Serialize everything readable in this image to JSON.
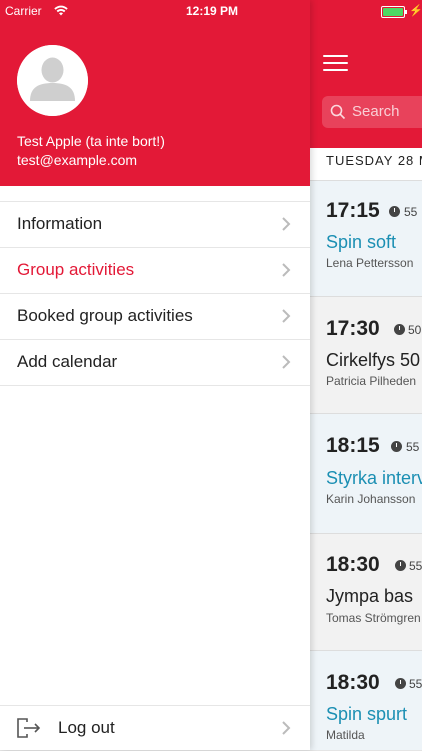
{
  "status_bar": {
    "carrier": "Carrier",
    "time": "12:19 PM"
  },
  "profile": {
    "name": "Test Apple (ta inte bort!)",
    "email": "test@example.com"
  },
  "menu": {
    "items": [
      {
        "label": "Information",
        "active": false
      },
      {
        "label": "Group activities",
        "active": true
      },
      {
        "label": "Booked group activities",
        "active": false
      },
      {
        "label": "Add calendar",
        "active": false
      }
    ],
    "logout_label": "Log out"
  },
  "main": {
    "search_placeholder": "Search",
    "date_header": "TUESDAY 28 M",
    "activities": [
      {
        "time": "17:15",
        "duration": "55",
        "title": "Spin soft",
        "instructor": "Lena Pettersson",
        "style": "teal"
      },
      {
        "time": "17:30",
        "duration": "50",
        "title": "Cirkelfys 50",
        "instructor": "Patricia Pilheden",
        "style": "dark"
      },
      {
        "time": "18:15",
        "duration": "55",
        "title": "Styrka interv",
        "instructor": "Karin Johansson",
        "style": "teal"
      },
      {
        "time": "18:30",
        "duration": "55",
        "title": "Jympa bas",
        "instructor": "Tomas Strömgren",
        "style": "dark"
      },
      {
        "time": "18:30",
        "duration": "55",
        "title": "Spin spurt",
        "instructor": "Matilda",
        "style": "teal"
      }
    ]
  },
  "colors": {
    "brand_red": "#e31937",
    "accent_teal": "#1b8fb3"
  }
}
